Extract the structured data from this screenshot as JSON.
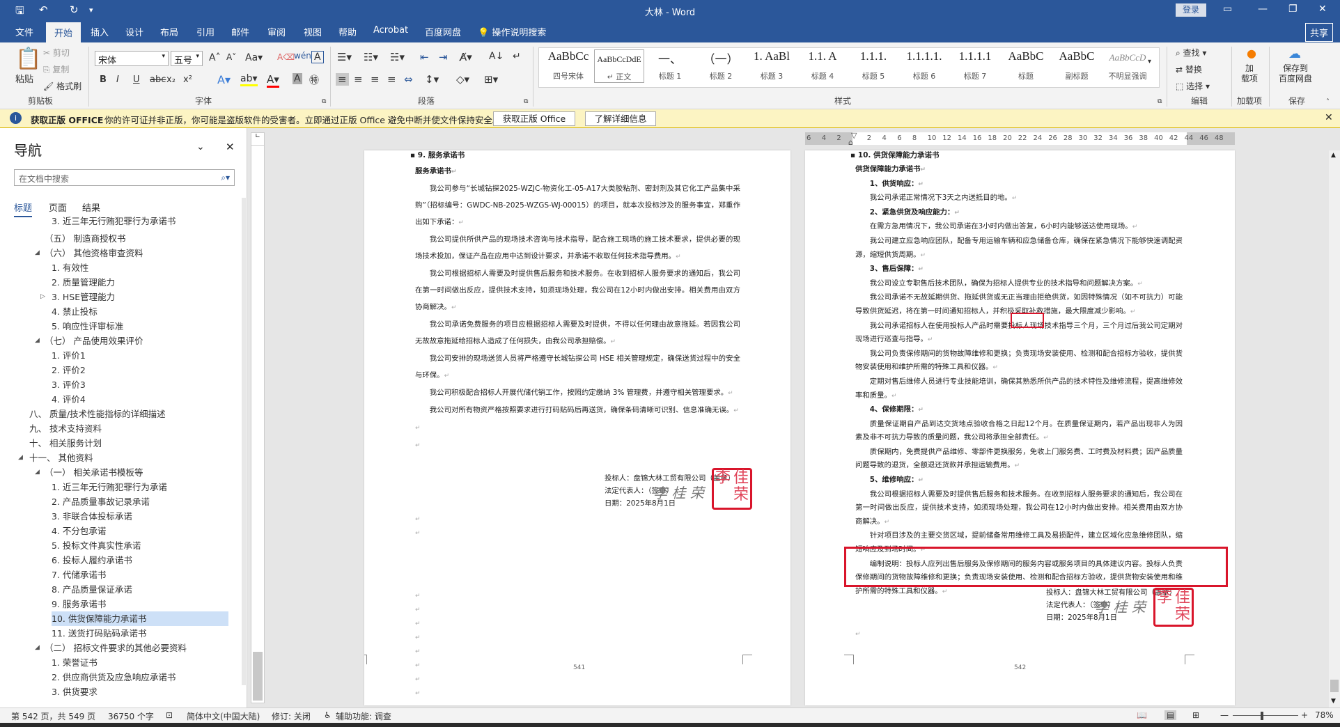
{
  "titlebar": {
    "title": "大林 - Word",
    "login": "登录",
    "save_icon": "save-icon",
    "undo_icon": "undo-icon",
    "redo_icon": "redo-icon"
  },
  "tabs": [
    "文件",
    "开始",
    "插入",
    "设计",
    "布局",
    "引用",
    "邮件",
    "审阅",
    "视图",
    "帮助",
    "Acrobat",
    "百度网盘"
  ],
  "tell_me": "操作说明搜索",
  "share": "共享",
  "ribbon": {
    "clipboard": {
      "paste": "粘贴",
      "cut": "剪切",
      "copy": "复制",
      "format_painter": "格式刷",
      "label": "剪贴板"
    },
    "font": {
      "name": "宋体",
      "size": "五号",
      "label": "字体",
      "buttons": [
        "B",
        "I",
        "U",
        "abc",
        "x₂",
        "x²"
      ]
    },
    "paragraph": {
      "label": "段落"
    },
    "styles": {
      "label": "样式",
      "items": [
        {
          "preview": "AaBbCc",
          "name": "四号宋体"
        },
        {
          "preview": "AaBbCcDdE",
          "name": "↵ 正文"
        },
        {
          "preview": "一、",
          "name": "标题 1"
        },
        {
          "preview": "（一）",
          "name": "标题 2"
        },
        {
          "preview": "1. AaBl",
          "name": "标题 3"
        },
        {
          "preview": "1.1. A",
          "name": "标题 4"
        },
        {
          "preview": "1.1.1.",
          "name": "标题 5"
        },
        {
          "preview": "1.1.1.1.",
          "name": "标题 6"
        },
        {
          "preview": "1.1.1.1",
          "name": "标题 7"
        },
        {
          "preview": "AaBbC",
          "name": "标题"
        },
        {
          "preview": "AaBbC",
          "name": "副标题"
        },
        {
          "preview": "AaBbCcD",
          "name": "不明显强调"
        }
      ]
    },
    "editing": {
      "find": "查找",
      "replace": "替换",
      "select": "选择",
      "label": "编辑"
    },
    "addins": {
      "btn": "加\n载项",
      "label": "加载项"
    },
    "save": {
      "btn": "保存到\n百度网盘",
      "label": "保存"
    }
  },
  "infobar": {
    "title": "获取正版 OFFICE",
    "message": "你的许可证并非正版，你可能是盗版软件的受害者。立即通过正版 Office 避免中断并使文件保持安全。",
    "btn1": "获取正版 Office",
    "btn2": "了解详细信息"
  },
  "nav": {
    "title": "导航",
    "search_placeholder": "在文档中搜索",
    "tabs": [
      "标题",
      "页面",
      "结果"
    ],
    "items": [
      {
        "level": 3,
        "text": "3. 近三年无行贿犯罪行为承诺书"
      },
      {
        "level": 2,
        "text": "（五）  制造商授权书"
      },
      {
        "level": 2,
        "text": "（六）  其他资格审查资料",
        "toggle": "expanded"
      },
      {
        "level": 3,
        "text": "1. 有效性"
      },
      {
        "level": 3,
        "text": "2. 质量管理能力"
      },
      {
        "level": 3,
        "text": "3. HSE管理能力",
        "toggle": "collapsed"
      },
      {
        "level": 3,
        "text": "4. 禁止投标"
      },
      {
        "level": 3,
        "text": "5. 响应性评审标准"
      },
      {
        "level": 2,
        "text": "（七）  产品使用效果评价",
        "toggle": "expanded"
      },
      {
        "level": 3,
        "text": "1. 评价1"
      },
      {
        "level": 3,
        "text": "2. 评价2"
      },
      {
        "level": 3,
        "text": "3. 评价3"
      },
      {
        "level": 3,
        "text": "4. 评价4"
      },
      {
        "level": 1,
        "text": "八、 质量/技术性能指标的详细描述"
      },
      {
        "level": 1,
        "text": "九、 技术支持资料"
      },
      {
        "level": 1,
        "text": "十、 相关服务计划"
      },
      {
        "level": 1,
        "text": "十一、 其他资料",
        "toggle": "expanded"
      },
      {
        "level": 2,
        "text": "（一）  相关承诺书模板等",
        "toggle": "expanded"
      },
      {
        "level": 3,
        "text": "1. 近三年无行贿犯罪行为承诺"
      },
      {
        "level": 3,
        "text": "2. 产品质量事故记录承诺"
      },
      {
        "level": 3,
        "text": "3. 非联合体投标承诺"
      },
      {
        "level": 3,
        "text": "4. 不分包承诺"
      },
      {
        "level": 3,
        "text": "5. 投标文件真实性承诺"
      },
      {
        "level": 3,
        "text": "6. 投标人履约承诺书"
      },
      {
        "level": 3,
        "text": "7. 代储承诺书"
      },
      {
        "level": 3,
        "text": "8. 产品质量保证承诺"
      },
      {
        "level": 3,
        "text": "9. 服务承诺书"
      },
      {
        "level": 3,
        "text": "10. 供货保障能力承诺书",
        "selected": true
      },
      {
        "level": 3,
        "text": "11. 送货打码贴码承诺书"
      },
      {
        "level": 2,
        "text": "（二）  招标文件要求的其他必要资料",
        "toggle": "expanded"
      },
      {
        "level": 3,
        "text": "1. 荣誉证书"
      },
      {
        "level": 3,
        "text": "2. 供应商供货及应急响应承诺书"
      },
      {
        "level": 3,
        "text": "3. 供货要求"
      }
    ]
  },
  "ruler": [
    "6",
    "4",
    "2",
    "",
    "2",
    "4",
    "6",
    "8",
    "10",
    "12",
    "14",
    "16",
    "18",
    "20",
    "22",
    "24",
    "26",
    "28",
    "30",
    "32",
    "34",
    "36",
    "38",
    "40",
    "42",
    "44",
    "46",
    "48"
  ],
  "page1": {
    "heading": "9. 服务承诺书",
    "title": "服务承诺书",
    "paras": [
      "我公司参与“长城钻探2025-WZJC-物资化工-05-A17大类胶粘剂、密封剂及其它化工产品集中采购”（招标编号：GWDC-NB-2025-WZGS-WJ-00015）的项目，就本次投标涉及的服务事宜，郑重作出如下承诺：",
      "我公司提供所供产品的现场技术咨询与技术指导，配合施工现场的施工技术要求，提供必要的现场技术投加，保证产品在应用中达到设计要求，并承诺不收取任何技术指导费用。",
      "我公司根据招标人需要及时提供售后服务和技术服务。在收到招标人服务要求的通知后，我公司在第一时间做出反应，提供技术支持，如须现场处理，我公司在12小时内做出安排。相关费用由双方协商解决。",
      "我公司承诺免费服务的项目应根据招标人需要及时提供，不得以任何理由故意拖延。若因我公司无故故意拖延给招标人造成了任何损失，由我公司承担赔偿。",
      "我公司安排的现场送货人员将严格遵守长城钻探公司 HSE 相关管理规定，确保送货过程中的安全与环保。",
      "我公司积极配合招标人开展代储代销工作，按照约定缴纳 3% 管理费，并遵守相关管理要求。",
      "我公司对所有物资严格按照要求进行打码贴码后再送货，确保条码清晰可识别、信息准确无误。"
    ],
    "bidder": "投标人：盘锦大林工贸有限公司（盖章）",
    "rep": "法定代表人：（签章）",
    "date": "日期：2025年8月1日",
    "signature": "李桂荣",
    "stamp": "李佳荣",
    "page_no": "541"
  },
  "page2": {
    "heading": "10. 供货保障能力承诺书",
    "title": "供货保障能力承诺书",
    "paras": [
      {
        "b": true,
        "t": "1、供货响应："
      },
      {
        "t": "我公司承诺正常情况下3天之内送抵目的地。"
      },
      {
        "b": true,
        "t": "2、紧急供货及响应能力："
      },
      {
        "t": "在需方急用情况下，我公司承诺在3小时内做出答复，6小时内能够送达使用现场。"
      },
      {
        "t": "我公司建立应急响应团队，配备专用运输车辆和应急储备仓库，确保在紧急情况下能够快速调配资源，缩短供货周期。"
      },
      {
        "b": true,
        "t": "3、售后保障："
      },
      {
        "t": "我公司设立专职售后技术团队，确保为招标人提供专业的技术指导和问题解决方案。"
      },
      {
        "t": "我公司承诺不无故延期供货、拖延供货或无正当理由拒绝供货，如因特殊情况（如不可抗力）可能导致供货延迟，将在第一时间通知招标人，并积极采取补救措施，最大限度减少影响。"
      },
      {
        "t": "我公司承诺招标人在使用投标人产品时需要投标人现场技术指导三个月，三个月过后我公司定期对现场进行巡查与指导。"
      },
      {
        "t": "我公司负责保修期间的货物故障维修和更换；负责现场安装使用、检测和配合招标方验收，提供货物安装使用和维护所需的特殊工具和仪器。"
      },
      {
        "t": "定期对售后维修人员进行专业技能培训，确保其熟悉所供产品的技术特性及维修流程，提高维修效率和质量。"
      },
      {
        "b": true,
        "t": "4、保修期限："
      },
      {
        "t": "质量保证期自产品到达交货地点验收合格之日起12个月。在质量保证期内，若产品出现非人为因素及非不可抗力导致的质量问题，我公司将承担全部责任。"
      },
      {
        "t": "质保期内，免费提供产品维修、零部件更换服务，免收上门服务费、工时费及材料费；因产品质量问题导致的退货，全额退还货款并承担运输费用。"
      },
      {
        "b": true,
        "t": "5、维修响应："
      },
      {
        "t": "我公司根据招标人需要及时提供售后服务和技术服务。在收到招标人服务要求的通知后，我公司在第一时间做出反应，提供技术支持，如须现场处理，我公司在12小时内做出安排。相关费用由双方协商解决。"
      },
      {
        "t": "针对项目涉及的主要交货区域，提前储备常用维修工具及易损配件，建立区域化应急维修团队，缩短响应及到场时间。"
      },
      {
        "t": "编制说明：投标人应列出售后服务及保修期间的服务内容或服务项目的具体建议内容。投标人负责保修期间的货物故障维修和更换；负责现场安装使用、检测和配合招标方验收，提供货物安装使用和维护所需的特殊工具和仪器。"
      }
    ],
    "bidder": "投标人：盘锦大林工贸有限公司（盖章）",
    "rep": "法定代表人：（签章）",
    "date": "日期：2025年8月1日",
    "signature": "李桂荣",
    "stamp": "李佳荣",
    "page_no": "542"
  },
  "highlight_color": "#d9152b",
  "status": {
    "page": "第 542 页，共 549 页",
    "words": "36750 个字",
    "language": "简体中文(中国大陆)",
    "track": "修订: 关闭",
    "accessibility": "辅助功能: 调查",
    "zoom": "78%",
    "zoom_level": 78
  }
}
